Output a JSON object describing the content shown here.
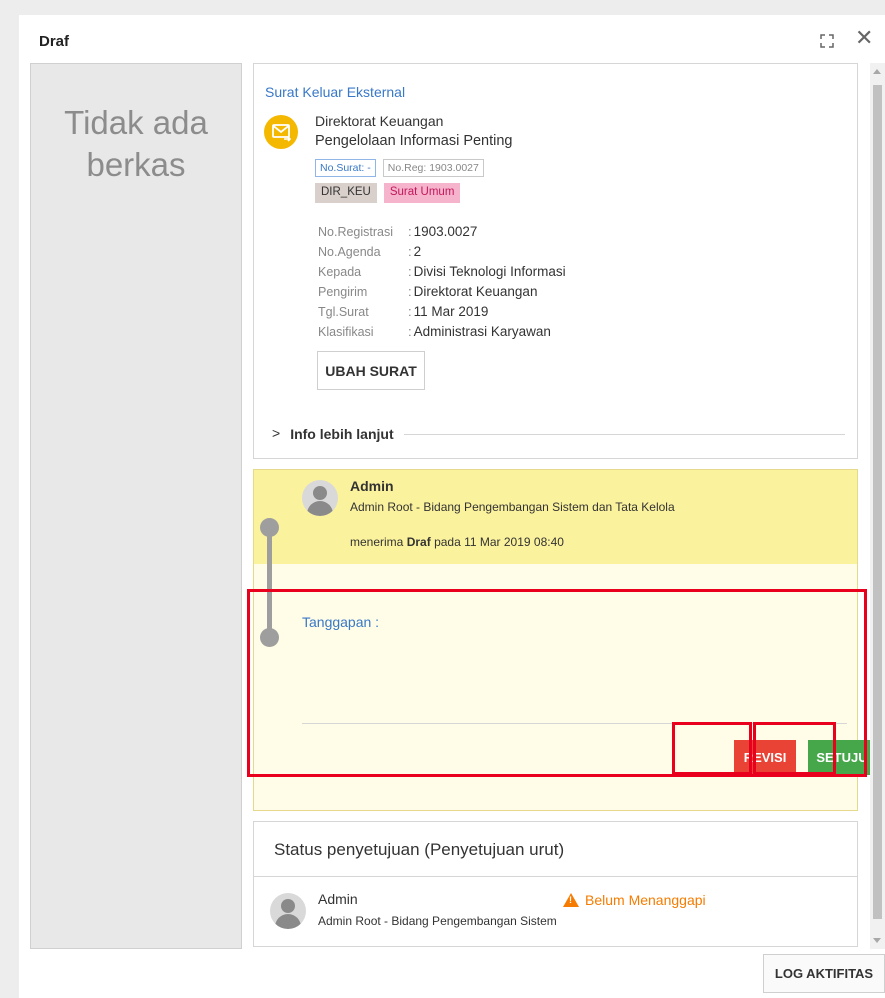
{
  "dialog": {
    "title": "Draf",
    "left_panel": {
      "empty_message": "Tidak ada berkas"
    },
    "letter": {
      "type": "Surat Keluar Eksternal",
      "sender": "Direktorat Keuangan",
      "subject": "Pengelolaan Informasi Penting",
      "tags_outline": [
        "No.Surat: -",
        "No.Reg: 1903.0027"
      ],
      "tags_fill": [
        "DIR_KEU",
        "Surat Umum"
      ],
      "details": [
        {
          "label": "No.Registrasi",
          "value": "1903.0027"
        },
        {
          "label": "No.Agenda",
          "value": "2"
        },
        {
          "label": "Kepada",
          "value": "Divisi Teknologi Informasi"
        },
        {
          "label": "Pengirim",
          "value": "Direktorat Keuangan"
        },
        {
          "label": "Tgl.Surat",
          "value": "11 Mar 2019"
        },
        {
          "label": "Klasifikasi",
          "value": "Administrasi Karyawan"
        }
      ],
      "edit_button": "UBAH SURAT",
      "more_info": "Info lebih lanjut"
    },
    "activity": {
      "actor": "Admin",
      "role": "Admin Root - Bidang Pengembangan Sistem dan Tata Kelola",
      "text_prefix": "menerima",
      "text_bold": "Draf",
      "text_suffix": "pada 11 Mar 2019 08:40",
      "response_label": "Tanggapan :",
      "revise_button": "REVISI",
      "approve_button": "SETUJU"
    },
    "status": {
      "title": "Status penyetujuan (Penyetujuan urut)",
      "approver_name": "Admin",
      "approver_role": "Admin Root - Bidang Pengembangan Sistem dan Tata Kelola",
      "state": "Belum Menanggapi"
    },
    "log_button": "LOG AKTIFITAS"
  },
  "colors": {
    "link_blue": "#3878c8",
    "revise_red": "#e94335",
    "approve_green": "#46a74a",
    "highlight_red": "#e8001c",
    "warning_orange": "#f57c00"
  },
  "icons": [
    "expand-icon",
    "close-icon",
    "mail-icon",
    "chevron-right-icon",
    "avatar-icon",
    "warning-icon"
  ]
}
